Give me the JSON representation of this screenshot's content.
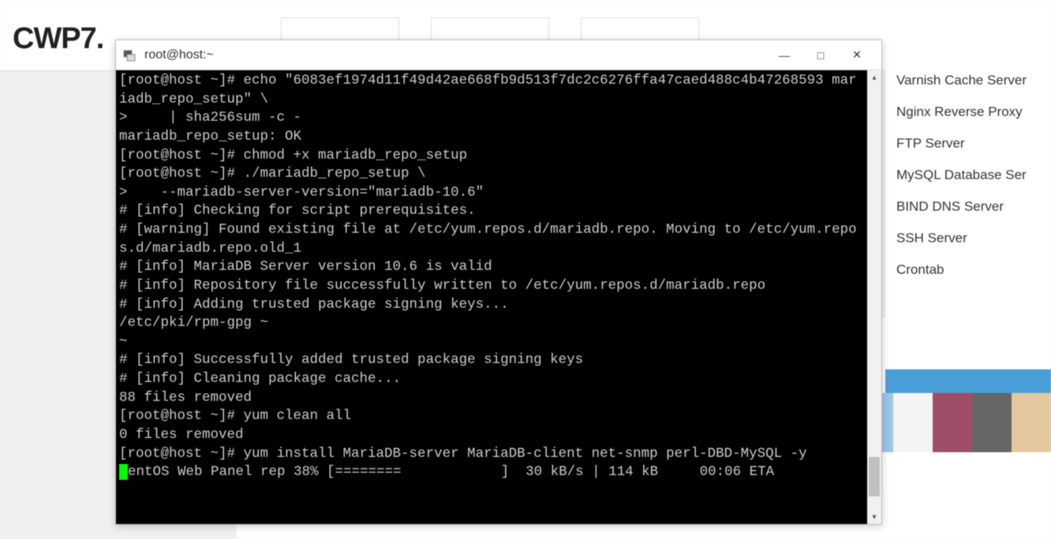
{
  "page": {
    "logo": "CWP7."
  },
  "terminal": {
    "title": "root@host:~",
    "lines": [
      "[root@host ~]# echo \"6083ef1974d11f49d42ae668fb9d513f7dc2c6276ffa47caed488c4b47268593 mariadb_repo_setup\" \\",
      ">     | sha256sum -c -",
      "mariadb_repo_setup: OK",
      "[root@host ~]# chmod +x mariadb_repo_setup",
      "[root@host ~]# ./mariadb_repo_setup \\",
      ">    --mariadb-server-version=\"mariadb-10.6\"",
      "# [info] Checking for script prerequisites.",
      "# [warning] Found existing file at /etc/yum.repos.d/mariadb.repo. Moving to /etc/yum.repos.d/mariadb.repo.old_1",
      "# [info] MariaDB Server version 10.6 is valid",
      "# [info] Repository file successfully written to /etc/yum.repos.d/mariadb.repo",
      "# [info] Adding trusted package signing keys...",
      "/etc/pki/rpm-gpg ~",
      "~",
      "# [info] Successfully added trusted package signing keys",
      "# [info] Cleaning package cache...",
      "88 files removed",
      "[root@host ~]# yum clean all",
      "0 files removed",
      "[root@host ~]# yum install MariaDB-server MariaDB-client net-snmp perl-DBD-MySQL -y"
    ],
    "progress_line": "CentOS Web Panel rep 38% [========            ]  30 kB/s | 114 kB     00:06 ETA"
  },
  "sidebar": {
    "items": [
      "Varnish Cache Server",
      "Nginx Reverse Proxy",
      "FTP Server",
      "MySQL Database Ser",
      "BIND DNS Server",
      "SSH Server",
      "Crontab"
    ]
  },
  "colors": {
    "squares": [
      "#9fc4e8",
      "#f4f4f4",
      "#9f4c66",
      "#666666",
      "#e6c89f"
    ]
  },
  "window_controls": {
    "minimize": "—",
    "maximize": "□",
    "close": "✕"
  }
}
